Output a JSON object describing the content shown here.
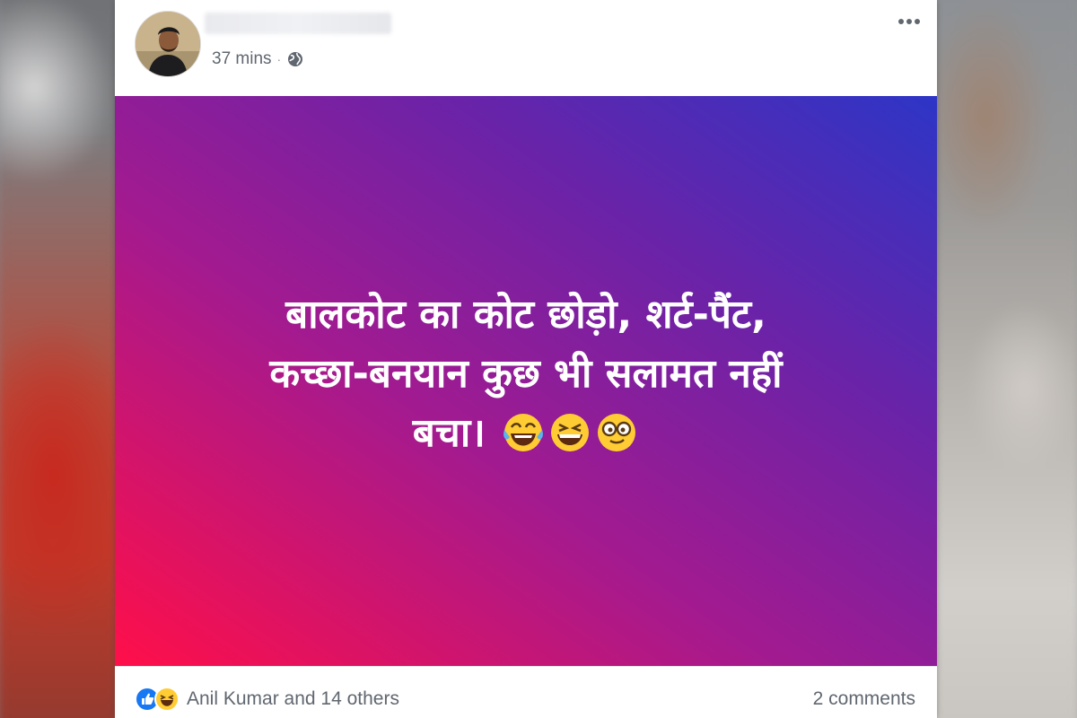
{
  "post": {
    "author_name": "",
    "timestamp": "37 mins",
    "separator": "·",
    "privacy_icon": "globe-icon",
    "menu_icon": "more-options-icon",
    "status_text_lines": [
      "बालकोट का कोट छोड़ो, शर्ट-पैंट,",
      "कच्छा-बनयान कुछ भी सलामत नहीं",
      "बचा।"
    ],
    "emojis": [
      "tears-of-joy-emoji",
      "grinning-squinting-emoji",
      "nerd-glasses-emoji"
    ],
    "background_gradient": [
      "#2d35c6",
      "#a41a8f",
      "#ff0f49"
    ],
    "reactions": {
      "icons": [
        "like-icon",
        "haha-icon"
      ],
      "text": "Anil Kumar and 14 others"
    },
    "comments_text": "2 comments"
  },
  "colors": {
    "facebook_blue": "#1877f2",
    "meta_gray": "#606770",
    "text_white": "#ffffff"
  }
}
